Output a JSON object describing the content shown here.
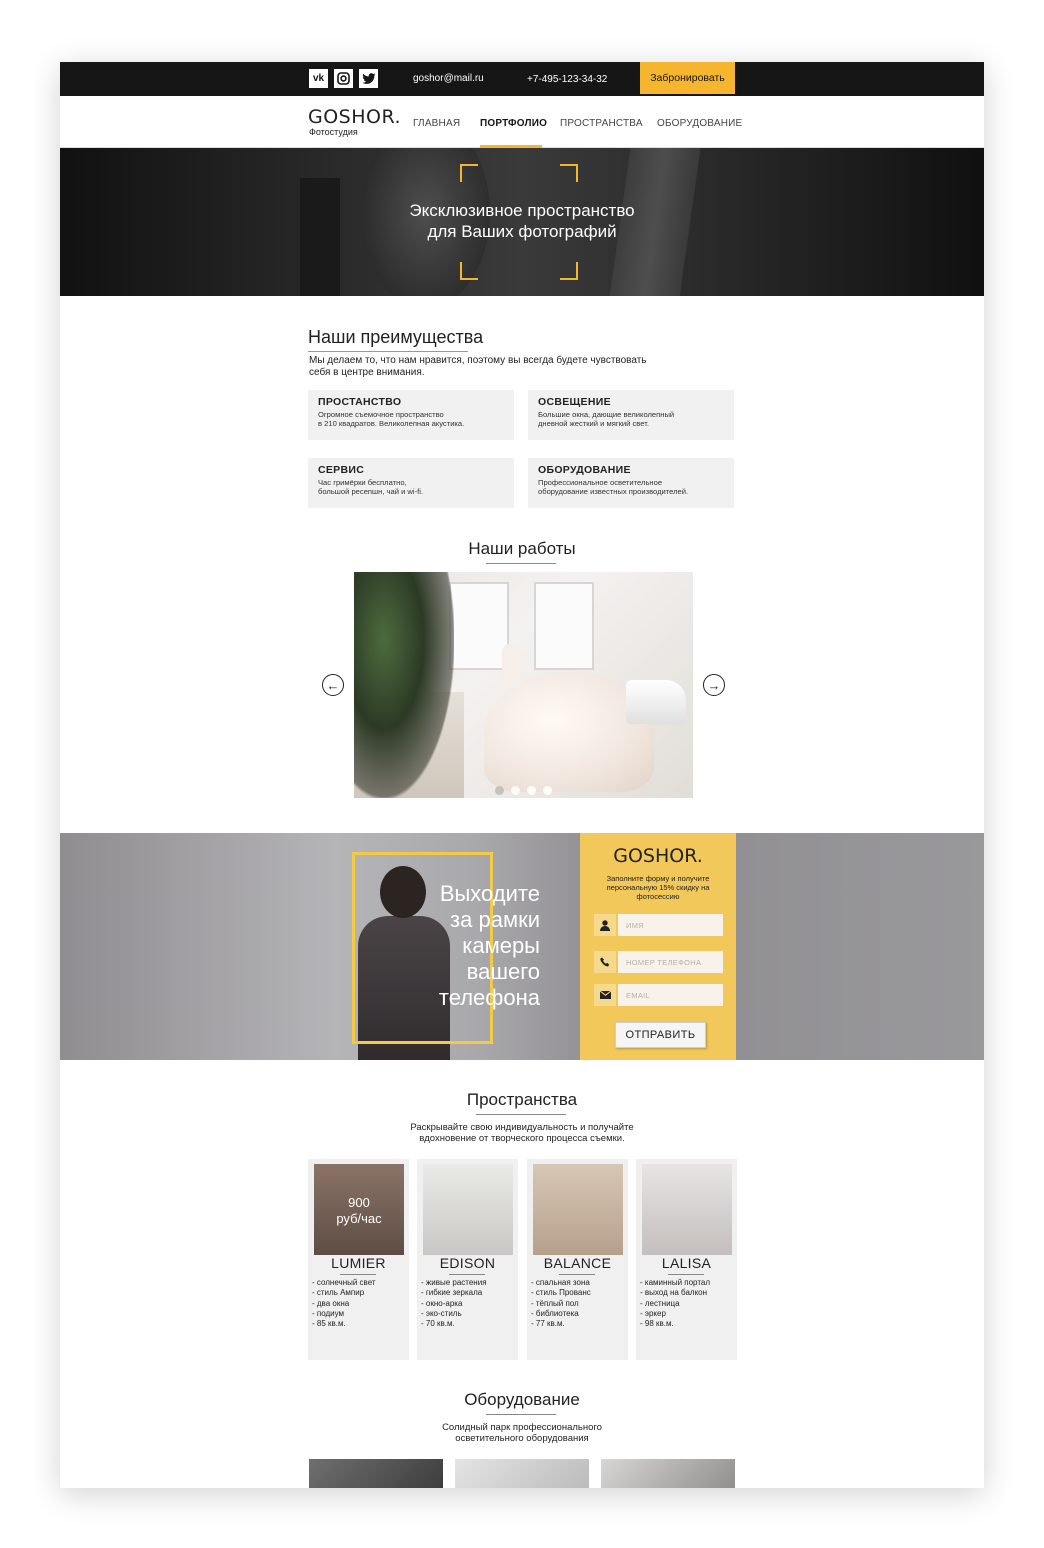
{
  "topbar": {
    "social": [
      {
        "name": "vk-icon",
        "glyph": "vk"
      },
      {
        "name": "instagram-icon",
        "glyph": "◎"
      },
      {
        "name": "twitter-icon",
        "glyph": "🐦"
      }
    ],
    "email": "goshor@mail.ru",
    "phone": "+7-495-123-34-32",
    "book_label": "Забронировать"
  },
  "nav": {
    "logo": "GOSHOR.",
    "logo_sub": "Фотостудия",
    "items": [
      "ГЛАВНАЯ",
      "ПОРТФОЛИО",
      "ПРОСТРАНСТВА",
      "ОБОРУДОВАНИЕ"
    ],
    "active_index": 1
  },
  "hero": {
    "title_line1": "Эксклюзивное пространство",
    "title_line2": "для Ваших фотографий"
  },
  "advantages": {
    "title": "Наши преимущества",
    "text": "Мы делаем то, что нам нравится, поэтому вы всегда будете чувствовать себя в центре внимания.",
    "cards": [
      {
        "title": "ПРОСТАНСТВО",
        "line1": "Огромное съемочное пространство",
        "line2": "в 210 квадратов. Великолепная акустика."
      },
      {
        "title": "ОСВЕЩЕНИЕ",
        "line1": "Большие окна, дающие великолепный",
        "line2": "дневной жесткий и мягкий свет."
      },
      {
        "title": "СЕРВИС",
        "line1": "Час гримёрки бесплатно,",
        "line2": "большой ресепшн, чай и wi-fi."
      },
      {
        "title": "ОБОРУДОВАНИЕ",
        "line1": "Профессиональное осветительное",
        "line2": "оборудование известных производителей."
      }
    ]
  },
  "works": {
    "title": "Наши работы",
    "slides_total": 4,
    "active_slide": 1,
    "prev_glyph": "←",
    "next_glyph": "→"
  },
  "promo": {
    "title_lines": [
      "Выходите",
      "за рамки",
      "камеры",
      "вашего",
      "телефона"
    ],
    "form_logo": "GOSHOR.",
    "form_text": "Заполните форму и получите персональную 15% скидку на фотосессию",
    "fields": [
      {
        "icon": "user-icon",
        "glyph": "👤",
        "placeholder": "ИМЯ"
      },
      {
        "icon": "phone-icon",
        "glyph": "📞",
        "placeholder": "НОМЕР ТЕЛЕФОНА"
      },
      {
        "icon": "mail-icon",
        "glyph": "✉",
        "placeholder": "EMAIL"
      }
    ],
    "submit_label": "ОТПРАВИТЬ"
  },
  "spaces": {
    "title": "Пространства",
    "text_line1": "Раскрывайте свою индивидуальность и получайте",
    "text_line2": "вдохновение от творческого процесса съемки.",
    "items": [
      {
        "name": "LUMIER",
        "price_line1": "900",
        "price_line2": "руб/час",
        "features": [
          "- солнечный свет",
          "- стиль Ампир",
          "- два окна",
          "- подиум",
          "- 85 кв.м."
        ],
        "img_color": "#7a6559"
      },
      {
        "name": "EDISON",
        "price_line1": "",
        "price_line2": "",
        "features": [
          "- живые растения",
          "- гибкие зеркала",
          "- окно-арка",
          "- эко-стиль",
          "- 70 кв.м."
        ],
        "img_color": "#d9d9d6"
      },
      {
        "name": "BALANCE",
        "price_line1": "",
        "price_line2": "",
        "features": [
          "- спальная зона",
          "- стиль Прованс",
          "- тёплый пол",
          "- библиотека",
          "- 77 кв.м."
        ],
        "img_color": "#c9b9aa"
      },
      {
        "name": "LALISA",
        "price_line1": "",
        "price_line2": "",
        "features": [
          "- каминный портал",
          "- выход на балкон",
          "- лестница",
          "- эркер",
          "- 98 кв.м."
        ],
        "img_color": "#d6d3d2"
      }
    ]
  },
  "equipment": {
    "title": "Оборудование",
    "text_line1": "Солидный парк профессионального",
    "text_line2": "осветительного оборудования"
  },
  "colors": {
    "accent": "#f5b52f",
    "form_bg": "#f2c85a",
    "dark": "#161616"
  }
}
